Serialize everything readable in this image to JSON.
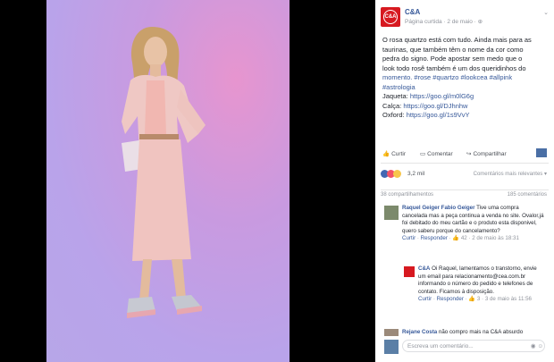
{
  "post": {
    "page_name": "C&A",
    "logo_text": "C&A",
    "meta": "Página curtida · 2 de maio · ",
    "text_lines": [
      "O rosa quartzo está com tudo. Ainda mais para as",
      "taurinas, que também têm o nome da cor como",
      "pedra do signo. Pode apostar sem medo que o",
      "look todo rosê também é um dos queridinhos do"
    ],
    "hashtags": "momento. #rose #quartzo #lookcea #allpink",
    "hashtags2": "#astrologia",
    "links": [
      {
        "label": "Jaqueta: ",
        "url": "https://goo.gl/m0lG6g"
      },
      {
        "label": "Calça: ",
        "url": "https://goo.gl/DJhnhw"
      },
      {
        "label": "Oxford: ",
        "url": "https://goo.gl/1s9VvY"
      }
    ]
  },
  "actions": {
    "like": "Curtir",
    "comment": "Comentar",
    "share": "Compartilhar"
  },
  "reactions": {
    "count": "3,2 mil",
    "relevance": "Comentários mais relevantes ▾"
  },
  "stats": {
    "shares": "38 compartilhamentos",
    "comments": "185 comentários"
  },
  "comments": [
    {
      "name": "Raquel Geiger Fabio Geiger",
      "text": " Tive uma compra cancelada mas a peça continua a venda no site. Ovalor,já foi debitado do meu cartão e o produto esta disponivel, quero saberu porque do cancelamento?",
      "like": "Curtir",
      "reply": "Responder",
      "likes": "42",
      "time": "2 de maio às 18:31"
    },
    {
      "name": "C&A",
      "text": " Oi Raquel, lamentamos o transtorno, envie um email para relacionamento@cea.com.br informando o número do pedido e telefones de contato. Ficamos à disposição.",
      "like": "Curtir",
      "reply": "Responder",
      "likes": "3",
      "time": "3 de maio às 11:56"
    },
    {
      "name": "Rejane Costa",
      "text": " não compro mais na C&A absurdo"
    }
  ],
  "input": {
    "placeholder": "Escreva um comentário..."
  },
  "colors": {
    "brand": "#d71920",
    "link": "#365899",
    "bg_purple": "#b9a3ea"
  },
  "icons": [
    "chevron-down-icon",
    "like-icon",
    "comment-icon",
    "share-icon",
    "camera-icon",
    "emoji-icon"
  ]
}
